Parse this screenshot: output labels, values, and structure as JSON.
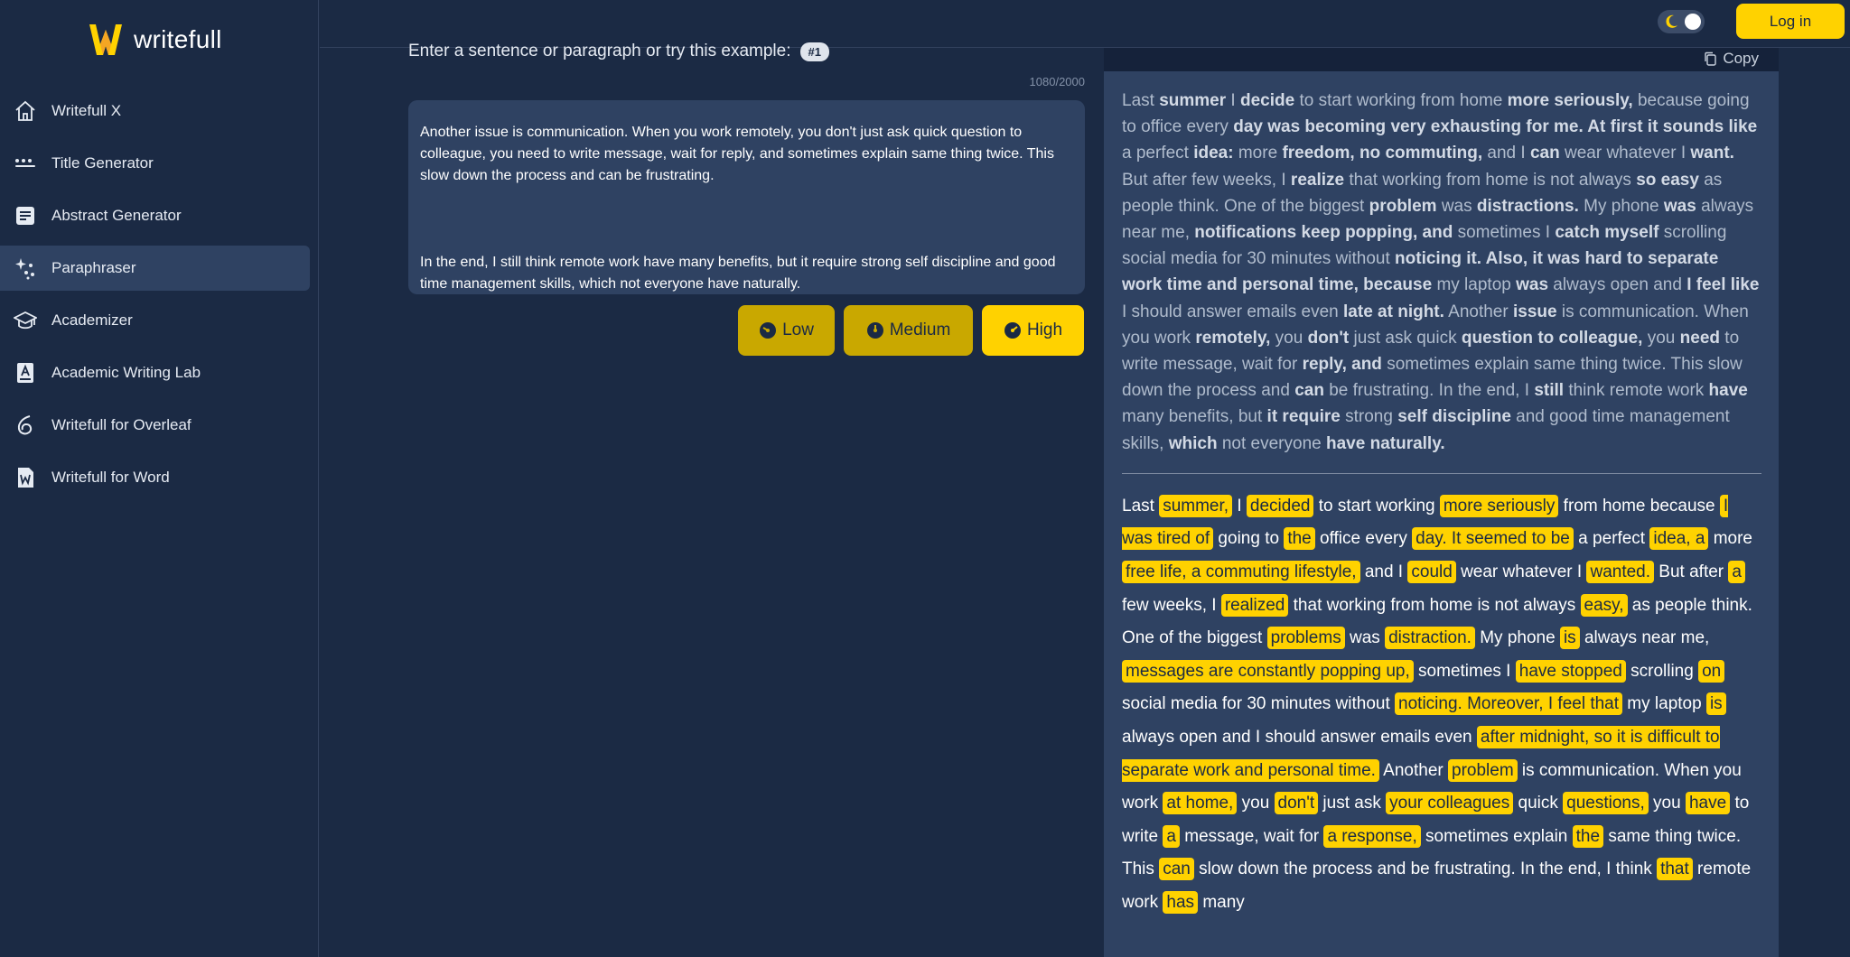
{
  "brand": {
    "name": "writefull",
    "accent": "#ffd200"
  },
  "sidebar": {
    "items": [
      {
        "label": "Writefull X",
        "icon": "home-icon"
      },
      {
        "label": "Title Generator",
        "icon": "dots-icon"
      },
      {
        "label": "Abstract Generator",
        "icon": "document-icon"
      },
      {
        "label": "Paraphraser",
        "icon": "sparkle-icon",
        "active": true
      },
      {
        "label": "Academizer",
        "icon": "graduation-cap-icon"
      },
      {
        "label": "Academic Writing Lab",
        "icon": "book-icon"
      },
      {
        "label": "Writefull for Overleaf",
        "icon": "overleaf-icon"
      },
      {
        "label": "Writefull for Word",
        "icon": "word-icon"
      }
    ]
  },
  "topbar": {
    "login_label": "Log in",
    "theme_toggle": "dark"
  },
  "input": {
    "prompt": "Enter a sentence or paragraph or try this example:",
    "example_chip": "#1",
    "counter": "1080/2000",
    "paragraph1": "Another issue is communication. When you work remotely, you don't just ask quick question to colleague, you need to write message, wait for reply, and sometimes explain same thing twice. This slow down the process and can be frustrating.",
    "paragraph2": "In the end, I still think remote work have many benefits, but it require strong self discipline and good time management skills, which not everyone have naturally."
  },
  "levels": {
    "low": "Low",
    "medium": "Medium",
    "high": "High",
    "selected": "High"
  },
  "output": {
    "copy_label": "Copy",
    "original_segments": [
      {
        "t": "Last "
      },
      {
        "t": "summer",
        "b": true
      },
      {
        "t": " I "
      },
      {
        "t": "decide",
        "b": true
      },
      {
        "t": " to start working from home "
      },
      {
        "t": "more seriously,",
        "b": true
      },
      {
        "t": " because going to office every "
      },
      {
        "t": "day was becoming very exhausting for me. At first it sounds like",
        "b": true
      },
      {
        "t": " a perfect "
      },
      {
        "t": "idea:",
        "b": true
      },
      {
        "t": " more "
      },
      {
        "t": "freedom, no commuting,",
        "b": true
      },
      {
        "t": " and I "
      },
      {
        "t": "can",
        "b": true
      },
      {
        "t": " wear whatever I "
      },
      {
        "t": "want.",
        "b": true
      },
      {
        "t": " But after few weeks, I "
      },
      {
        "t": "realize",
        "b": true
      },
      {
        "t": " that working from home is not always "
      },
      {
        "t": "so easy",
        "b": true
      },
      {
        "t": " as people think. One of the biggest "
      },
      {
        "t": "problem",
        "b": true
      },
      {
        "t": " was "
      },
      {
        "t": "distractions.",
        "b": true
      },
      {
        "t": " My phone "
      },
      {
        "t": "was",
        "b": true
      },
      {
        "t": " always near me, "
      },
      {
        "t": "notifications keep popping, and",
        "b": true
      },
      {
        "t": " sometimes I "
      },
      {
        "t": "catch myself",
        "b": true
      },
      {
        "t": " scrolling social media for 30 minutes without "
      },
      {
        "t": "noticing it. Also, it was hard to separate work time and personal time, because",
        "b": true
      },
      {
        "t": " my laptop "
      },
      {
        "t": "was",
        "b": true
      },
      {
        "t": " always open and "
      },
      {
        "t": "I feel like",
        "b": true
      },
      {
        "t": " I should answer emails even "
      },
      {
        "t": "late at night.",
        "b": true
      },
      {
        "t": " Another "
      },
      {
        "t": "issue",
        "b": true
      },
      {
        "t": " is communication. When you work "
      },
      {
        "t": "remotely,",
        "b": true
      },
      {
        "t": " you "
      },
      {
        "t": "don't",
        "b": true
      },
      {
        "t": " just ask quick "
      },
      {
        "t": "question to colleague,",
        "b": true
      },
      {
        "t": " you "
      },
      {
        "t": "need",
        "b": true
      },
      {
        "t": " to write message, wait for "
      },
      {
        "t": "reply, and",
        "b": true
      },
      {
        "t": " sometimes explain same thing twice. This slow down the process and "
      },
      {
        "t": "can",
        "b": true
      },
      {
        "t": " be frustrating. In the end, I "
      },
      {
        "t": "still",
        "b": true
      },
      {
        "t": " think remote work "
      },
      {
        "t": "have",
        "b": true
      },
      {
        "t": " many benefits, but "
      },
      {
        "t": "it require",
        "b": true
      },
      {
        "t": " strong "
      },
      {
        "t": "self discipline",
        "b": true
      },
      {
        "t": " and good time management skills, "
      },
      {
        "t": "which",
        "b": true
      },
      {
        "t": " not everyone "
      },
      {
        "t": "have naturally.",
        "b": true
      }
    ],
    "result_segments": [
      {
        "t": "Last "
      },
      {
        "t": "summer,",
        "h": true
      },
      {
        "t": " I "
      },
      {
        "t": "decided",
        "h": true
      },
      {
        "t": " to start working "
      },
      {
        "t": "more seriously",
        "h": true
      },
      {
        "t": " from home because "
      },
      {
        "t": "I was tired of",
        "h": true
      },
      {
        "t": " going to "
      },
      {
        "t": "the",
        "h": true
      },
      {
        "t": " office every "
      },
      {
        "t": "day. It seemed to be",
        "h": true
      },
      {
        "t": " a perfect "
      },
      {
        "t": "idea, a",
        "h": true
      },
      {
        "t": " more "
      },
      {
        "t": "free life, a commuting lifestyle,",
        "h": true
      },
      {
        "t": " and I "
      },
      {
        "t": "could",
        "h": true
      },
      {
        "t": " wear whatever I "
      },
      {
        "t": "wanted.",
        "h": true
      },
      {
        "t": " But after "
      },
      {
        "t": "a",
        "h": true
      },
      {
        "t": " few weeks, I "
      },
      {
        "t": "realized",
        "h": true
      },
      {
        "t": " that working from home is not always "
      },
      {
        "t": "easy,",
        "h": true
      },
      {
        "t": " as people think. One of the biggest "
      },
      {
        "t": "problems",
        "h": true
      },
      {
        "t": " was "
      },
      {
        "t": "distraction.",
        "h": true
      },
      {
        "t": " My phone "
      },
      {
        "t": "is",
        "h": true
      },
      {
        "t": " always near me, "
      },
      {
        "t": "messages are constantly popping up,",
        "h": true
      },
      {
        "t": " sometimes I "
      },
      {
        "t": "have stopped",
        "h": true
      },
      {
        "t": " scrolling "
      },
      {
        "t": "on",
        "h": true
      },
      {
        "t": " social media for 30 minutes without "
      },
      {
        "t": "noticing. Moreover, I feel that",
        "h": true
      },
      {
        "t": " my laptop "
      },
      {
        "t": "is",
        "h": true
      },
      {
        "t": " always open and I should answer emails even "
      },
      {
        "t": "after midnight, so it is difficult to separate work and personal time.",
        "h": true
      },
      {
        "t": " Another "
      },
      {
        "t": "problem",
        "h": true
      },
      {
        "t": " is communication. When you work "
      },
      {
        "t": "at home,",
        "h": true
      },
      {
        "t": " you "
      },
      {
        "t": "don't",
        "h": true
      },
      {
        "t": " just ask "
      },
      {
        "t": "your colleagues",
        "h": true
      },
      {
        "t": " quick "
      },
      {
        "t": "questions,",
        "h": true
      },
      {
        "t": " you "
      },
      {
        "t": "have",
        "h": true
      },
      {
        "t": " to write "
      },
      {
        "t": "a",
        "h": true
      },
      {
        "t": " message, wait for "
      },
      {
        "t": "a response,",
        "h": true
      },
      {
        "t": " sometimes explain "
      },
      {
        "t": "the",
        "h": true
      },
      {
        "t": " same thing twice. This "
      },
      {
        "t": "can",
        "h": true
      },
      {
        "t": " slow down the process and be frustrating. In the end, I think "
      },
      {
        "t": "that",
        "h": true
      },
      {
        "t": " remote work "
      },
      {
        "t": "has",
        "h": true
      },
      {
        "t": " many"
      }
    ]
  }
}
